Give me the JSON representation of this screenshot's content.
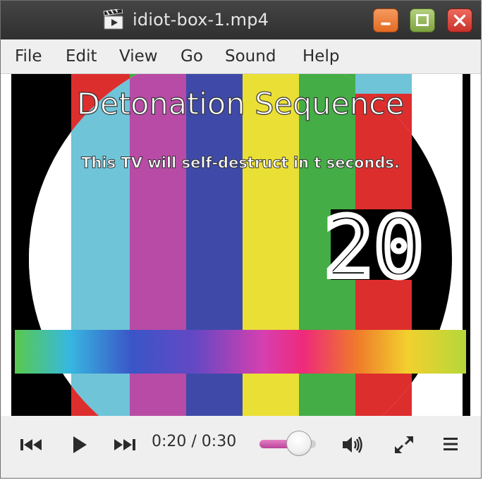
{
  "window": {
    "title": "idiot-box-1.mp4",
    "app_icon": "film-clapperboard-icon",
    "buttons": [
      "minimize-icon",
      "maximize-icon",
      "close-icon"
    ]
  },
  "menubar": {
    "items": [
      "File",
      "Edit",
      "View",
      "Go",
      "Sound",
      "Help"
    ]
  },
  "video": {
    "heading": "Detonation Sequence",
    "message": "This TV will self-destruct in t seconds.",
    "countdown": "20",
    "bar_colors": [
      "#6fc4d8",
      "#b84ba6",
      "#3f4aa8",
      "#eadf35",
      "#44ad45",
      "#dd2e2e"
    ]
  },
  "controls": {
    "time_readout": "0:20 / 0:30",
    "volume_level": 0.7,
    "icons": [
      "skip-back-icon",
      "play-icon",
      "skip-forward-icon",
      "volume-icon",
      "fullscreen-icon",
      "hamburger-menu-icon"
    ],
    "accent_color": "#c95aa8"
  }
}
